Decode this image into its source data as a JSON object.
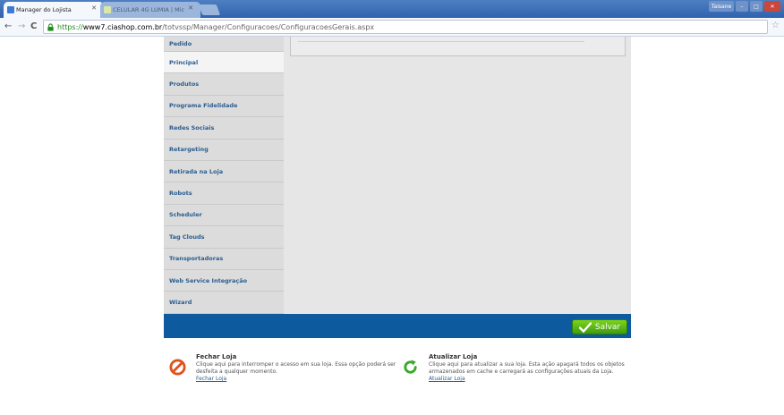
{
  "browser": {
    "tabs": [
      {
        "title": "Manager do Lojista",
        "active": true
      },
      {
        "title": "CELULAR 4G LUMIA | Mic",
        "active": false
      }
    ],
    "url": {
      "scheme": "https://",
      "host": "www7.ciashop.com.br",
      "path": "/totvssp/Manager/Configuracoes/ConfiguracoesGerais.aspx"
    },
    "user_label": "Taisane"
  },
  "sidebar": {
    "items": [
      {
        "label": "Pedido"
      },
      {
        "label": "Principal"
      },
      {
        "label": "Produtos"
      },
      {
        "label": "Programa Fidelidade"
      },
      {
        "label": "Redes Sociais"
      },
      {
        "label": "Retargeting"
      },
      {
        "label": "Retirada na Loja"
      },
      {
        "label": "Robots"
      },
      {
        "label": "Scheduler"
      },
      {
        "label": "Tag Clouds"
      },
      {
        "label": "Transportadoras"
      },
      {
        "label": "Web Service Integração"
      },
      {
        "label": "Wizard"
      }
    ]
  },
  "actions": {
    "save_label": "Salvar",
    "close_store": {
      "title": "Fechar Loja",
      "description": "Clique aqui para interromper o acesso em sua loja. Essa opção poderá ser desfeita a qualquer momento.",
      "link": "Fechar Loja"
    },
    "refresh_store": {
      "title": "Atualizar Loja",
      "description": "Clique aqui para atualizar a sua loja. Esta ação apagará todos os objetos armazenados em cache e carregará as configurações atuais da Loja.",
      "link": "Atualizar Loja"
    }
  },
  "colors": {
    "accent_blue": "#0d5a9e",
    "save_green": "#5bb51a",
    "sidebar_text": "#2b5d8f"
  }
}
